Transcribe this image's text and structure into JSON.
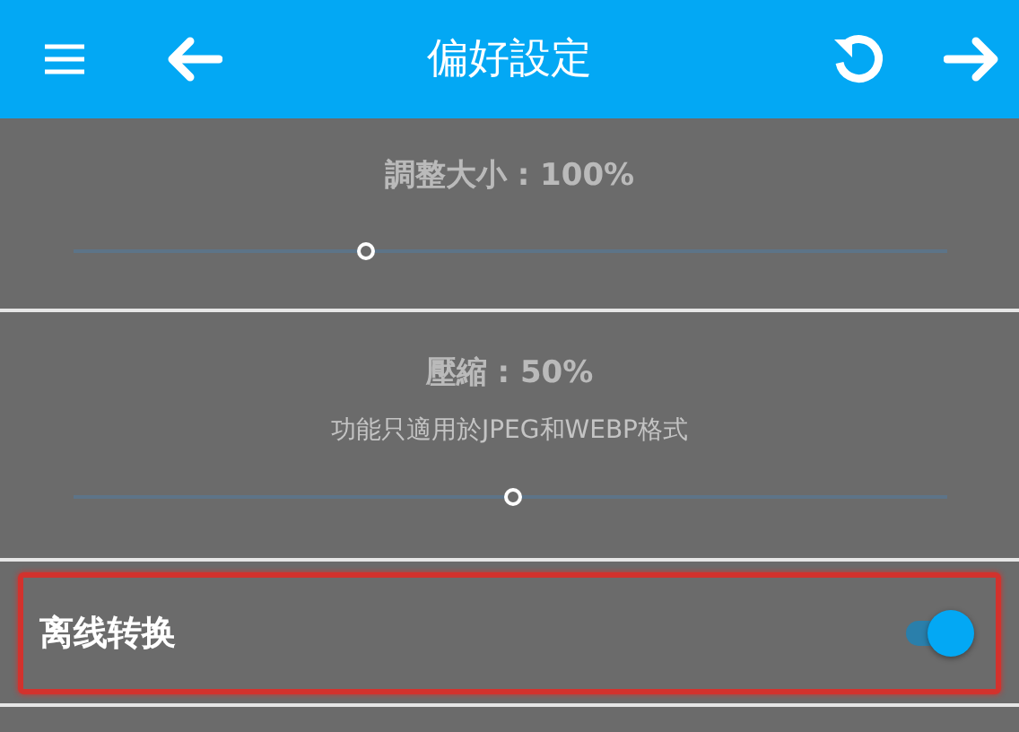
{
  "app_bar": {
    "title": "偏好設定",
    "left_actions": [
      {
        "kind": "menu"
      },
      {
        "kind": "back"
      }
    ],
    "right_actions": [
      {
        "kind": "reset"
      },
      {
        "kind": "forward"
      }
    ]
  },
  "settings": [
    {
      "kind": "slider",
      "title": "調整大小 : 100%",
      "level": 0.335
    },
    {
      "kind": "slider",
      "title": "壓縮 : 50%",
      "subtitle": "功能只適用於JPEG和WEBP格式",
      "level": 0.505
    },
    {
      "kind": "switch",
      "title": "离线转换",
      "on": true,
      "highlighted": true
    }
  ]
}
